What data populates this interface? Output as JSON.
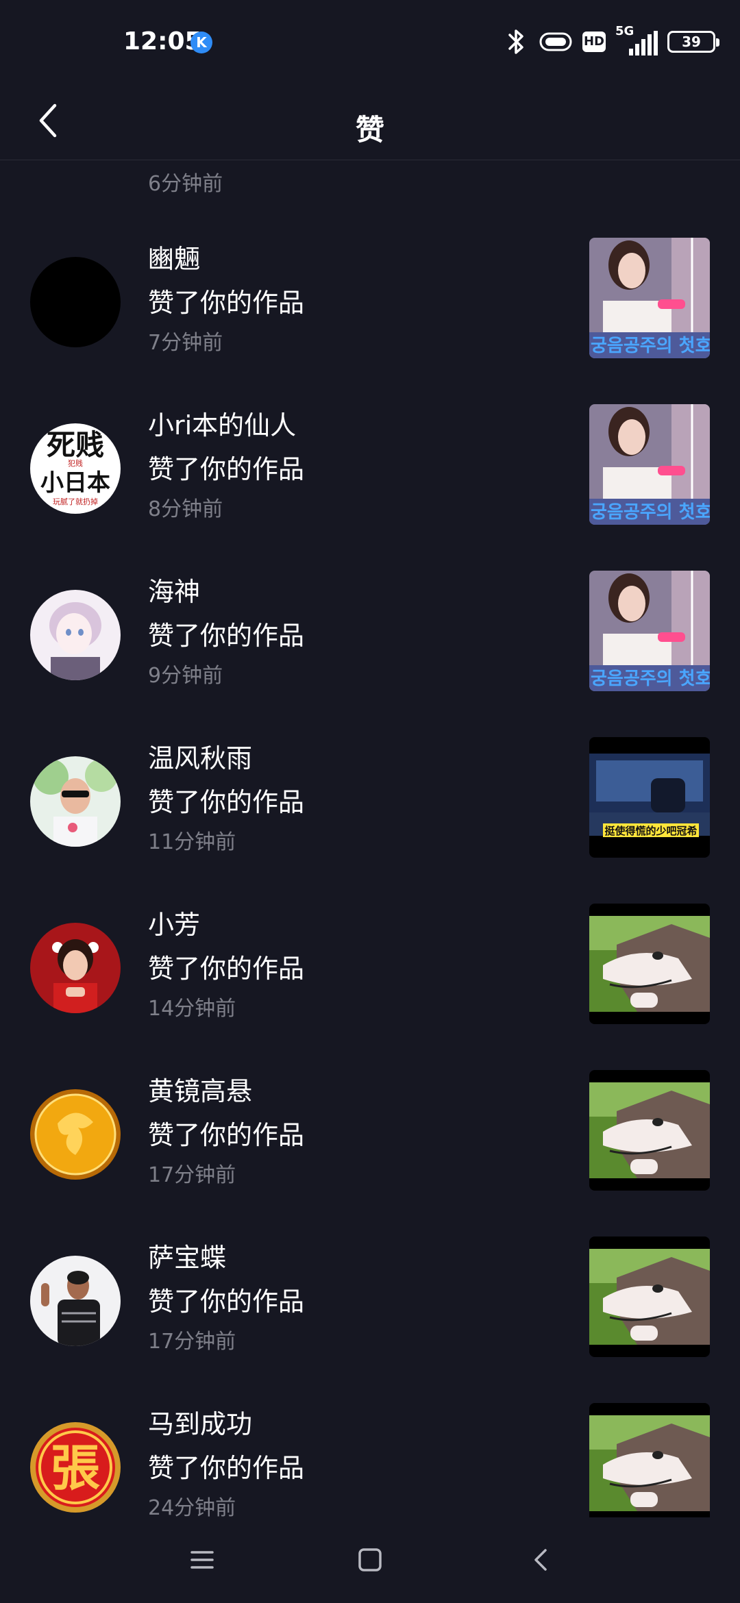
{
  "status_bar": {
    "time": "12:05",
    "app_badge": "K",
    "hd_label": "HD",
    "network_label": "5G",
    "battery_level": "39"
  },
  "header": {
    "title": "赞"
  },
  "partial_entry": {
    "time": "6分钟前"
  },
  "entries": [
    {
      "name": "豳魎",
      "action": "赞了你的作品",
      "time": "7分钟前",
      "avatar": "black",
      "thumb": "archery"
    },
    {
      "name": "小ri本的仙人",
      "action": "赞了你的作品",
      "time": "8分钟前",
      "avatar": "text",
      "thumb": "archery"
    },
    {
      "name": "海神",
      "action": "赞了你的作品",
      "time": "9分钟前",
      "avatar": "anime",
      "thumb": "archery"
    },
    {
      "name": "温风秋雨",
      "action": "赞了你的作品",
      "time": "11分钟前",
      "avatar": "photo",
      "thumb": "car"
    },
    {
      "name": "小芳",
      "action": "赞了你的作品",
      "time": "14分钟前",
      "avatar": "red",
      "thumb": "wolf"
    },
    {
      "name": "黄镜高悬",
      "action": "赞了你的作品",
      "time": "17分钟前",
      "avatar": "gold",
      "thumb": "wolf"
    },
    {
      "name": "萨宝蝶",
      "action": "赞了你的作品",
      "time": "17分钟前",
      "avatar": "man",
      "thumb": "wolf"
    },
    {
      "name": "马到成功",
      "action": "赞了你的作品",
      "time": "24分钟前",
      "avatar": "zhang",
      "thumb": "wolf"
    }
  ],
  "avatar_text": {
    "line1": "死贱",
    "small": "犯贱",
    "line2": "小日本",
    "caption": "玩腻了就扔掉",
    "zhang": "張"
  },
  "thumb_captions": {
    "archery": "궁음공주의 첫호",
    "car": "挺使得慌的少吧冠希"
  },
  "colors": {
    "background": "#161722",
    "text_primary": "#ffffff",
    "text_secondary": "#7f808a",
    "divider": "#2a2b36",
    "badge_blue": "#2f8cf6"
  },
  "icons": {
    "back": "chevron-left-icon",
    "bluetooth": "bluetooth-icon",
    "vibrate": "vibrate-icon",
    "signal": "signal-bars-icon",
    "battery": "battery-icon",
    "nav_menu": "menu-icon",
    "nav_home": "home-icon",
    "nav_back": "back-icon"
  }
}
